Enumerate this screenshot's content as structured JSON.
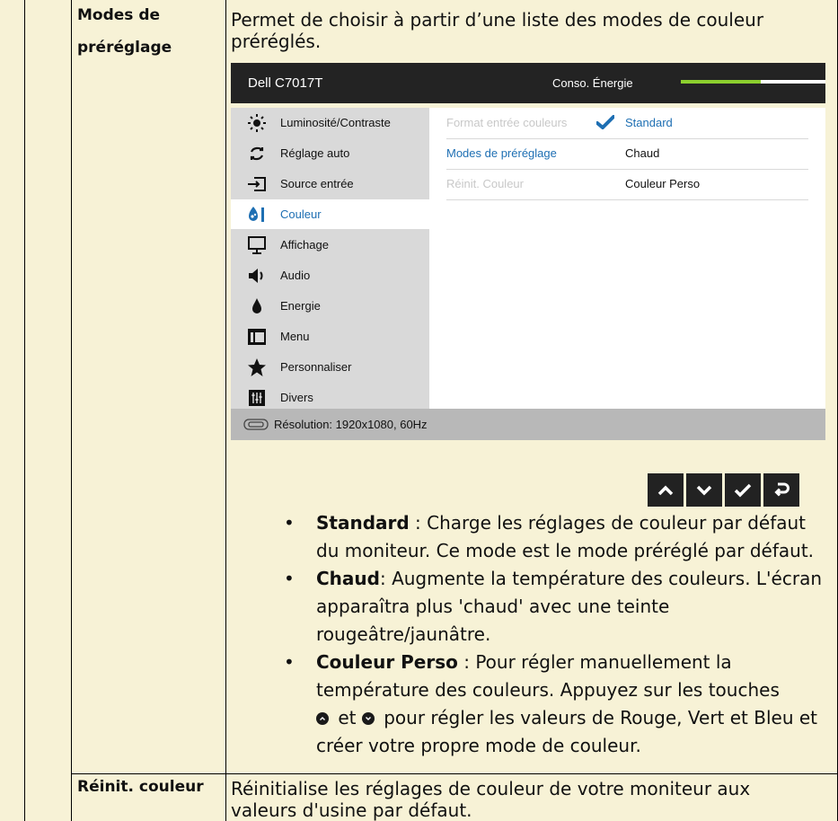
{
  "table": {
    "row1": {
      "label_line1": "Modes de",
      "label_line2": "préréglage",
      "desc_line1": "Permet de choisir à partir d’une liste des modes de couleur",
      "desc_line2": "préréglés."
    },
    "row2": {
      "label": "Réinit. couleur",
      "desc_line1": "Réinitialise les réglages de couleur de votre moniteur aux",
      "desc_line2": "valeurs d'usine par défaut."
    }
  },
  "osd": {
    "model": "Dell C7017T",
    "energy_label": "Conso. Énergie",
    "energy_level": 0.55,
    "energy_color": "#8ccf2e",
    "menu": [
      {
        "label": "Luminosité/Contraste",
        "icon": "brightness-icon"
      },
      {
        "label": "Réglage auto",
        "icon": "auto-adjust-icon"
      },
      {
        "label": "Source entrée",
        "icon": "input-source-icon"
      },
      {
        "label": "Couleur",
        "icon": "color-icon",
        "active": true
      },
      {
        "label": "Affichage",
        "icon": "display-icon"
      },
      {
        "label": "Audio",
        "icon": "audio-icon"
      },
      {
        "label": "Energie",
        "icon": "energy-icon"
      },
      {
        "label": "Menu",
        "icon": "menu-icon"
      },
      {
        "label": "Personnaliser",
        "icon": "star-icon"
      },
      {
        "label": "Divers",
        "icon": "others-icon"
      }
    ],
    "submenu": [
      {
        "key": "Format entrée couleurs",
        "value": "Standard"
      },
      {
        "key": "Modes de  préréglage",
        "value": "Chaud"
      },
      {
        "key": "Réinit. Couleur",
        "value": "Couleur Perso"
      }
    ],
    "footer": "Résolution: 1920x1080, 60Hz",
    "accent_color": "#1e6fb3"
  },
  "nav_buttons": [
    "up-icon",
    "down-icon",
    "check-icon",
    "back-icon"
  ],
  "bullets": [
    {
      "term": "Standard",
      "text": " : Charge les réglages de couleur par défaut du moniteur. Ce mode est le mode préréglé par défaut."
    },
    {
      "term": "Chaud",
      "text": ": Augmente la température des couleurs. L'écran apparaîtra plus 'chaud' avec une teinte rougeâtre/jaunâtre."
    },
    {
      "term": "Couleur Perso",
      "text": " : Pour régler manuellement la température des couleurs. Appuyez sur les touches",
      "text_et": " et ",
      "text_end": " pour régler les valeurs de Rouge, Vert et Bleu et créer votre propre mode de couleur."
    }
  ]
}
